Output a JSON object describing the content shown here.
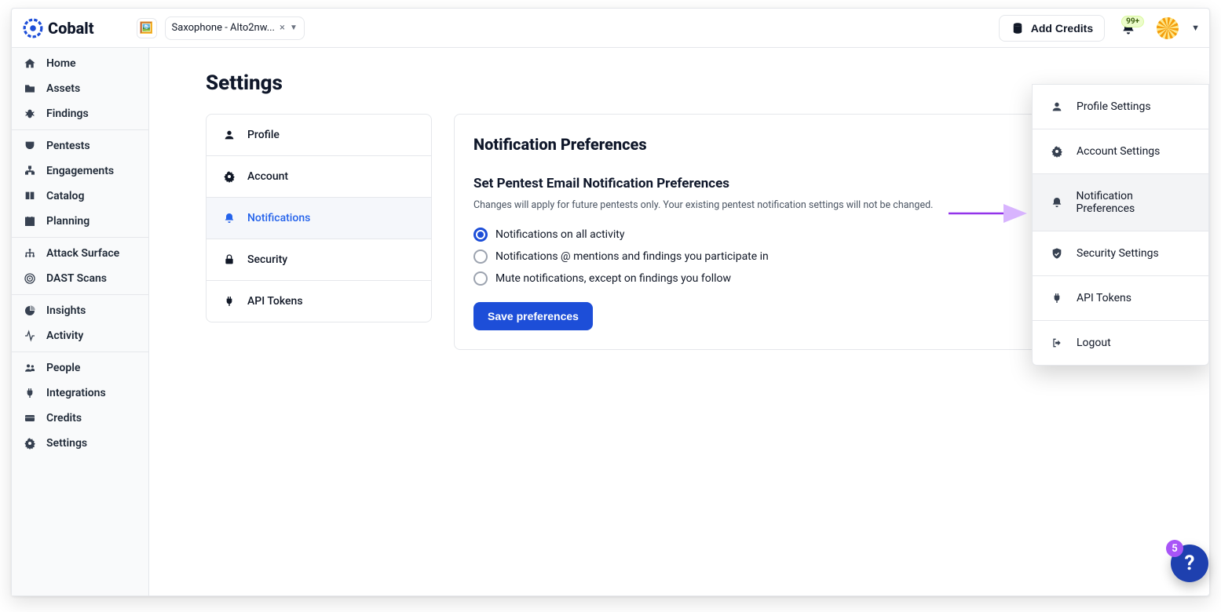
{
  "brand": "Cobalt",
  "org_emoji": "🖼️",
  "project_name": "Saxophone - Alto2nw...",
  "add_credits_label": "Add Credits",
  "notif_badge": "99+",
  "sidebar": {
    "groups": [
      {
        "items": [
          {
            "icon": "home",
            "label": "Home"
          },
          {
            "icon": "folder",
            "label": "Assets"
          },
          {
            "icon": "bug",
            "label": "Findings"
          }
        ]
      },
      {
        "items": [
          {
            "icon": "shieldbox",
            "label": "Pentests"
          },
          {
            "icon": "orgchart",
            "label": "Engagements"
          },
          {
            "icon": "book",
            "label": "Catalog"
          },
          {
            "icon": "calendar",
            "label": "Planning"
          }
        ]
      },
      {
        "items": [
          {
            "icon": "sitemap",
            "label": "Attack Surface"
          },
          {
            "icon": "target",
            "label": "DAST Scans"
          }
        ]
      },
      {
        "items": [
          {
            "icon": "piechart",
            "label": "Insights"
          },
          {
            "icon": "activity",
            "label": "Activity"
          }
        ]
      },
      {
        "items": [
          {
            "icon": "people",
            "label": "People"
          },
          {
            "icon": "plug",
            "label": "Integrations"
          },
          {
            "icon": "card",
            "label": "Credits"
          },
          {
            "icon": "gear",
            "label": "Settings"
          }
        ]
      }
    ]
  },
  "page_title": "Settings",
  "subnav": [
    {
      "icon": "user",
      "label": "Profile"
    },
    {
      "icon": "gear",
      "label": "Account"
    },
    {
      "icon": "bell",
      "label": "Notifications",
      "active": true
    },
    {
      "icon": "lock",
      "label": "Security"
    },
    {
      "icon": "plug",
      "label": "API Tokens"
    }
  ],
  "panel": {
    "heading": "Notification Preferences",
    "subheading": "Set Pentest Email Notification Preferences",
    "desc": "Changes will apply for future pentests only. Your existing pentest notification settings will not be changed.",
    "options": [
      {
        "label": "Notifications on all activity",
        "checked": true
      },
      {
        "label": "Notifications @ mentions and findings you participate in",
        "checked": false
      },
      {
        "label": "Mute notifications, except on findings you follow",
        "checked": false
      }
    ],
    "save_label": "Save preferences"
  },
  "dropdown": [
    {
      "icon": "user",
      "label": "Profile Settings"
    },
    {
      "icon": "gear",
      "label": "Account Settings"
    },
    {
      "icon": "bell",
      "label": "Notification Preferences",
      "hover": true
    },
    {
      "icon": "shieldcheck",
      "label": "Security Settings"
    },
    {
      "icon": "plug",
      "label": "API Tokens"
    },
    {
      "icon": "logout",
      "label": "Logout"
    }
  ],
  "help_count": "5"
}
